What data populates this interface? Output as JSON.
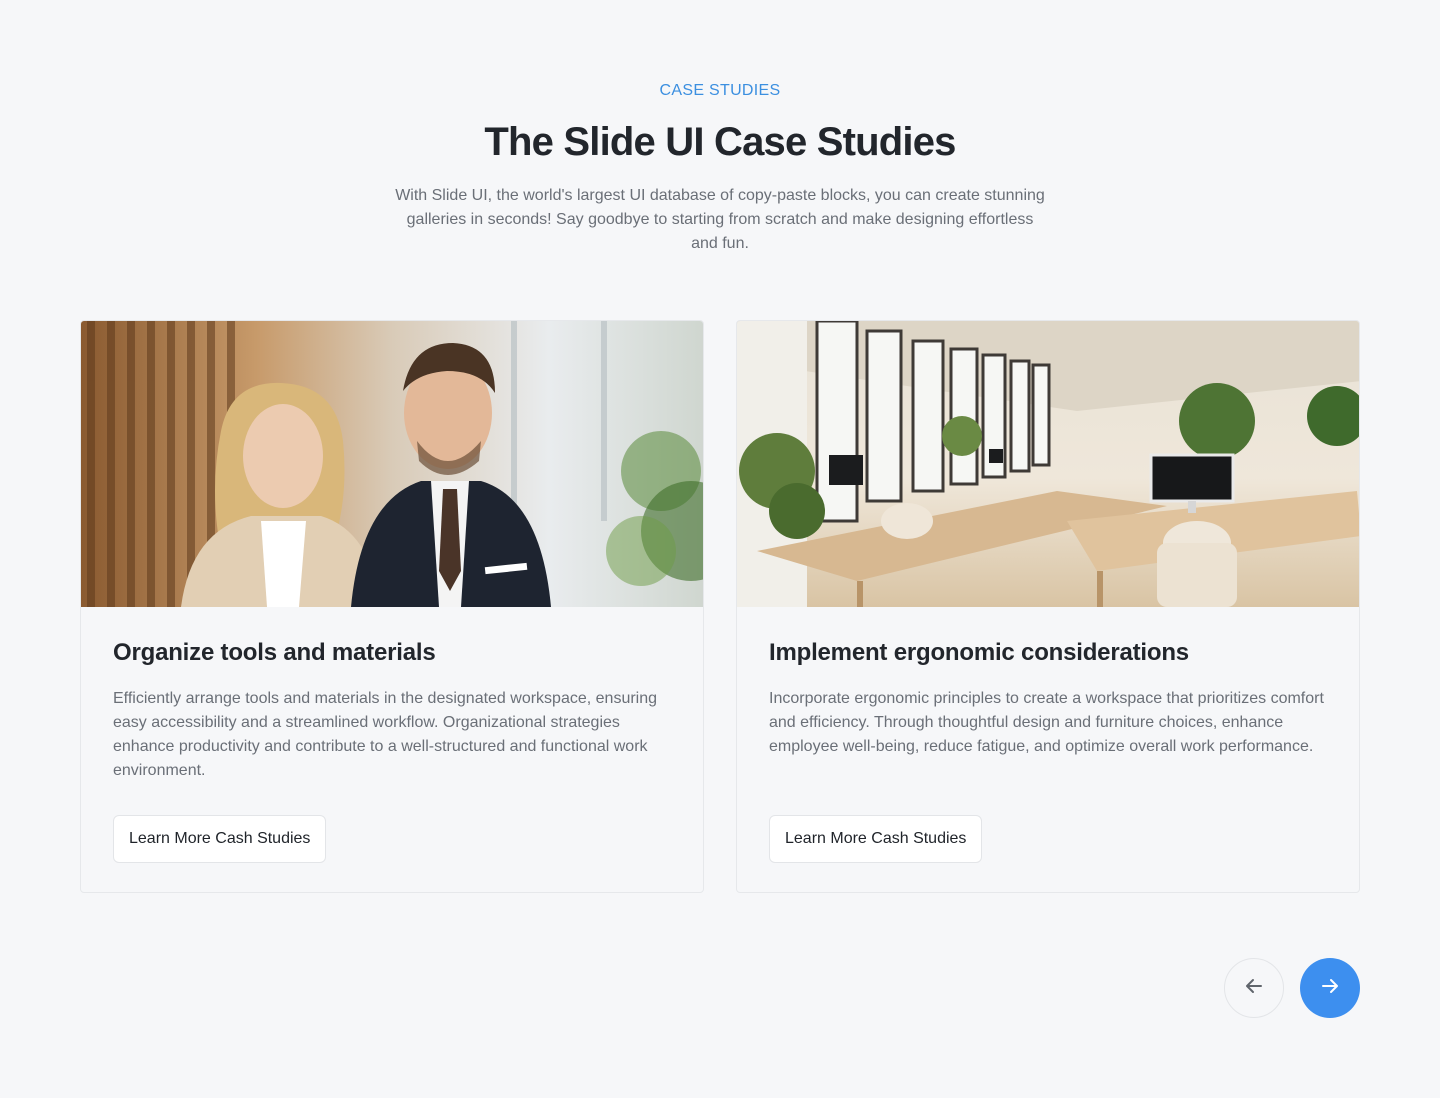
{
  "section": {
    "eyebrow": "CASE STUDIES",
    "title": "The Slide UI Case Studies",
    "subtitle": "With Slide UI, the world's largest UI database of copy-paste blocks, you can create stunning galleries in seconds! Say goodbye to starting from scratch and make designing effortless and fun."
  },
  "cards": [
    {
      "image_icon": "business-people-photo",
      "title": "Organize tools and materials",
      "text": "Efficiently arrange tools and materials in the designated workspace, ensuring easy accessibility and a streamlined workflow. Organizational strategies enhance productivity and contribute to a well-structured and functional work environment.",
      "button_label": "Learn More Cash Studies"
    },
    {
      "image_icon": "office-interior-photo",
      "title": "Implement ergonomic considerations",
      "text": "Incorporate ergonomic principles to create a workspace that prioritizes comfort and efficiency. Through thoughtful design and furniture choices, enhance employee well-being, reduce fatigue, and optimize overall work performance.",
      "button_label": "Learn More Cash Studies"
    }
  ],
  "navigation": {
    "prev_icon": "arrow-left-icon",
    "next_icon": "arrow-right-icon"
  },
  "colors": {
    "accent": "#3d8fef",
    "eyebrow": "#3b8fe0",
    "background": "#f6f7f9",
    "heading": "#22262c",
    "body_text": "#6a6f77"
  }
}
